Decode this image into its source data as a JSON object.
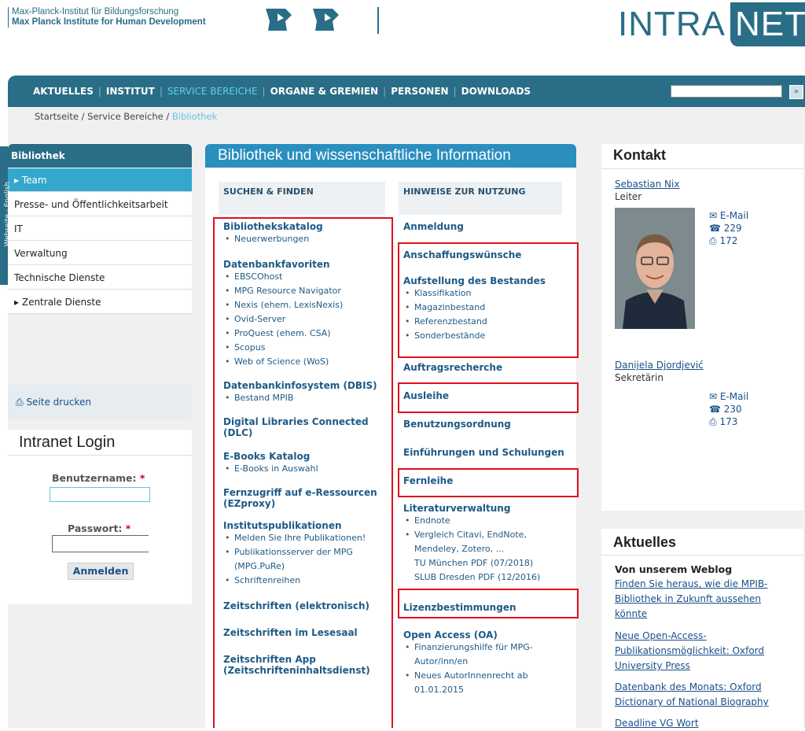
{
  "header": {
    "institute_de": "Max-Planck-Institut für Bildungsforschung",
    "institute_en": "Max Planck Institute for Human Development",
    "logo_left": "INTRA",
    "logo_right": "NET"
  },
  "nav": {
    "items": [
      "AKTUELLES",
      "INSTITUT",
      "SERVICE BEREICHE",
      "ORGANE & GREMIEN",
      "PERSONEN",
      "DOWNLOADS"
    ],
    "search_button": "»"
  },
  "breadcrumb": {
    "home": "Startseite",
    "sep": " / ",
    "section": "Service Bereiche",
    "current": "Bibliothek"
  },
  "sidebar": {
    "side_tab": "Webseite  ·  English",
    "title": "Bibliothek",
    "items": [
      "Team",
      "Presse- und Öffentlichkeitsarbeit",
      "IT",
      "Verwaltung",
      "Technische Dienste",
      "Zentrale Dienste"
    ],
    "print": "Seite drucken"
  },
  "login": {
    "title": "Intranet Login",
    "user_label": "Benutzername:",
    "pass_label": "Passwort:",
    "required": "*",
    "button": "Anmelden"
  },
  "main": {
    "title": "Bibliothek und wissenschaftliche Information",
    "col1_head": "SUCHEN & FINDEN",
    "col2_head": "HINWEISE ZUR NUTZUNG",
    "col1": {
      "katalog": "Bibliothekskatalog",
      "katalog_subs": [
        "Neuerwerbungen"
      ],
      "favoriten": "Datenbankfavoriten",
      "favoriten_subs": [
        "EBSCOhost",
        "MPG Resource Navigator",
        "Nexis (ehem. LexisNexis)",
        "Ovid-Server",
        "ProQuest (ehem. CSA)",
        "Scopus",
        "Web of Science (WoS)"
      ],
      "dbis": "Datenbankinfosystem (DBIS)",
      "dbis_subs": [
        "Bestand MPIB"
      ],
      "dlc": "Digital Libraries Connected (DLC)",
      "ebooks": "E-Books Katalog",
      "ebooks_subs": [
        "E-Books in Auswahl"
      ],
      "fernzugriff_1": "Fernzugriff auf e-Ressourcen",
      "fernzugriff_2": "(EZproxy)",
      "pub": "Institutspublikationen",
      "pub_subs": [
        "Melden Sie Ihre Publikationen!",
        "Publikationsserver der MPG",
        "Schriftenreihen"
      ],
      "pub_cont": "(MPG.PuRe)",
      "zs_elektro": "Zeitschriften (elektronisch)",
      "zs_lesesaal": "Zeitschriften im Lesesaal",
      "zs_app_1": "Zeitschriften App",
      "zs_app_2": "(Zeitschrifteninhaltsdienst)"
    },
    "col2": {
      "anmeldung": "Anmeldung",
      "anschaffung": "Anschaffungswünsche",
      "aufstellung": "Aufstellung des Bestandes",
      "aufstellung_subs": [
        "Klassifikation",
        "Magazinbestand",
        "Referenzbestand",
        "Sonderbestände"
      ],
      "auftrag": "Auftragsrecherche",
      "ausleihe": "Ausleihe",
      "benutzung": "Benutzungsordnung",
      "einfuehrung": "Einführungen und Schulungen",
      "fernleihe": "Fernleihe",
      "literatur": "Literaturverwaltung",
      "literatur_subs": [
        "Endnote",
        "Vergleich Citavi, EndNote,"
      ],
      "literatur_cont": [
        "Mendeley, Zotero, ...",
        "TU München PDF (07/2018)",
        "SLUB Dresden PDF (12/2016)"
      ],
      "lizenz": "Lizenzbestimmungen",
      "oa": "Open Access (OA)",
      "oa_subs": [
        "Finanzierungshilfe für MPG-",
        "Neues AutorInnenrecht ab"
      ],
      "oa_cont1": "Autor/inn/en",
      "oa_cont2": "01.01.2015"
    }
  },
  "kontakt": {
    "title": "Kontakt",
    "people": [
      {
        "name": "Sebastian Nix",
        "role": "Leiter",
        "email": "E-Mail",
        "phone": "229",
        "fax": "172"
      },
      {
        "name": "Danijela Djordjević",
        "role": "Sekretärin",
        "email": "E-Mail",
        "phone": "230",
        "fax": "173"
      }
    ]
  },
  "aktuelles": {
    "title": "Aktuelles",
    "weblog_head": "Von unserem Weblog",
    "items": [
      "Finden Sie heraus, wie die MPIB-Bibliothek in Zukunft aussehen könnte",
      "Neue Open-Access-Publikationsmöglichkeit: Oxford University Press",
      "Datenbank des Monats: Oxford Dictionary of National Biography",
      "Deadline VG Wort"
    ]
  }
}
